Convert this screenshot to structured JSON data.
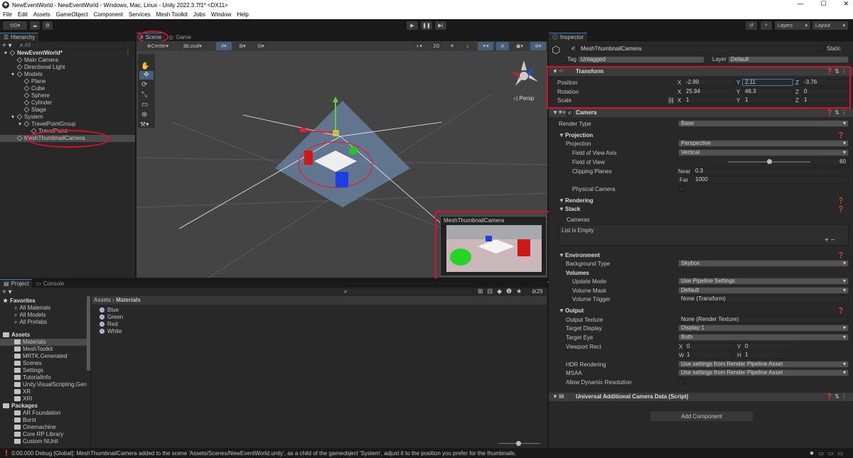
{
  "window": {
    "title": "NewEventWorld - NewEventWorld - Windows, Mac, Linux - Unity 2022.3.7f1* <DX11>",
    "min": "—",
    "max": "☐",
    "close": "✕"
  },
  "menu": [
    "File",
    "Edit",
    "Assets",
    "GameObject",
    "Component",
    "Services",
    "Mesh Toolkit",
    "Jobs",
    "Window",
    "Help"
  ],
  "toolbar": {
    "account": "D",
    "layers": "Layers",
    "layout": "Layout"
  },
  "hierarchy": {
    "tab": "Hierarchy",
    "search_placeholder": "All",
    "items": [
      {
        "label": "NewEventWorld*",
        "depth": 0
      },
      {
        "label": "Main Camera",
        "depth": 1
      },
      {
        "label": "Directional Light",
        "depth": 1
      },
      {
        "label": "Models",
        "depth": 1
      },
      {
        "label": "Plane",
        "depth": 2
      },
      {
        "label": "Cube",
        "depth": 2
      },
      {
        "label": "Sphere",
        "depth": 2
      },
      {
        "label": "Cylinder",
        "depth": 2
      },
      {
        "label": "Stage",
        "depth": 2
      },
      {
        "label": "System",
        "depth": 1
      },
      {
        "label": "TravelPointGroup",
        "depth": 2
      },
      {
        "label": "TravelPoint",
        "depth": 3
      },
      {
        "label": "MeshThumbnailCamera",
        "depth": 1
      }
    ]
  },
  "scene": {
    "tabs": [
      "Scene",
      "Game"
    ],
    "pivot": "Center",
    "space": "Local",
    "mode2d": "2D",
    "persp": "◁ Persp",
    "preview_title": "MeshThumbnailCamera"
  },
  "project": {
    "tabs": [
      "Project",
      "Console"
    ],
    "favorites_label": "Favorites",
    "favorites": [
      "All Materials",
      "All Models",
      "All Prefabs"
    ],
    "assets_label": "Assets",
    "assets": [
      "Materials",
      "MeshToolkit",
      "MRTK.Generated",
      "Scenes",
      "Settings",
      "TutorialInfo",
      "Unity.VisualScripting.Gene",
      "XR",
      "XRI"
    ],
    "packages_label": "Packages",
    "packages": [
      "AR Foundation",
      "Burst",
      "Cinemachine",
      "Core RP Library",
      "Custom NUnit"
    ],
    "breadcrumb_root": "Assets",
    "breadcrumb_current": "Materials",
    "files": [
      "Blue",
      "Green",
      "Red",
      "White"
    ],
    "count": "29"
  },
  "inspector": {
    "tab": "Inspector",
    "object_name": "MeshThumbnailCamera",
    "static_label": "Static",
    "tag_label": "Tag",
    "tag_value": "Untagged",
    "layer_label": "Layer",
    "layer_value": "Default",
    "transform": {
      "title": "Transform",
      "position_label": "Position",
      "position": [
        "-2.99",
        "2.11",
        "-3.76"
      ],
      "rotation_label": "Rotation",
      "rotation": [
        "25.94",
        "46.3",
        "0"
      ],
      "scale_label": "Scale",
      "scale": [
        "1",
        "1",
        "1"
      ]
    },
    "camera": {
      "title": "Camera",
      "render_type_label": "Render Type",
      "render_type": "Base",
      "projection_section": "Projection",
      "projection_label": "Projection",
      "projection": "Perspective",
      "fov_axis_label": "Field of View Axis",
      "fov_axis": "Vertical",
      "fov_label": "Field of View",
      "fov": "60",
      "fov_fraction": 0.5,
      "clipping_label": "Clipping Planes",
      "near_label": "Near",
      "near": "0.3",
      "far_label": "Far",
      "far": "1000",
      "physical_label": "Physical Camera",
      "rendering_section": "Rendering",
      "stack_section": "Stack",
      "cameras_label": "Cameras",
      "list_empty": "List is Empty",
      "environment_section": "Environment",
      "bg_type_label": "Background Type",
      "bg_type": "Skybox",
      "volumes_label": "Volumes",
      "update_mode_label": "Update Mode",
      "update_mode": "Use Pipeline Settings",
      "volume_mask_label": "Volume Mask",
      "volume_mask": "Default",
      "volume_trigger_label": "Volume Trigger",
      "volume_trigger": "None (Transform)",
      "output_section": "Output",
      "output_texture_label": "Output Texture",
      "output_texture": "None (Render Texture)",
      "target_display_label": "Target Display",
      "target_display": "Display 1",
      "target_eye_label": "Target Eye",
      "target_eye": "Both",
      "viewport_label": "Viewport Rect",
      "vx": "0",
      "vy": "0",
      "vw": "1",
      "vh": "1",
      "hdr_label": "HDR Rendering",
      "hdr": "Use settings from Render Pipeline Asset",
      "msaa_label": "MSAA",
      "msaa": "Use settings from Render Pipeline Asset",
      "dyn_label": "Allow Dynamic Resolution"
    },
    "uacd_title": "Universal Additional Camera Data (Script)",
    "add_component": "Add Component"
  },
  "status": "0:00.000 Debug [Global]: MeshThumbnailCamera added to the scene 'Assets/Scenes/NewEventWorld.unity', as a child of the gameobject 'System', adjust it to the position you prefer for the thumbnails."
}
